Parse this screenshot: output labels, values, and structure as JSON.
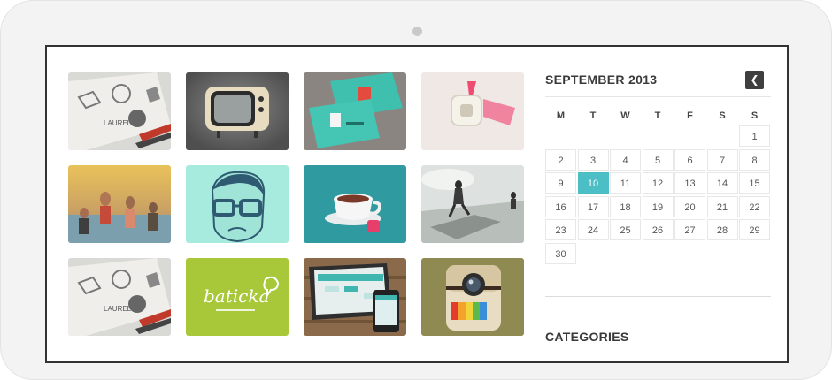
{
  "calendar": {
    "title": "SEPTEMBER 2013",
    "prev_icon": "chevron-left-icon",
    "weekdays": [
      "M",
      "T",
      "W",
      "T",
      "F",
      "S",
      "S"
    ],
    "today": "10",
    "days": [
      [
        "",
        "",
        "",
        "",
        "",
        "",
        "1"
      ],
      [
        "2",
        "3",
        "4",
        "5",
        "6",
        "7",
        "8"
      ],
      [
        "9",
        "10",
        "11",
        "12",
        "13",
        "14",
        "15"
      ],
      [
        "16",
        "17",
        "18",
        "19",
        "20",
        "21",
        "22"
      ],
      [
        "23",
        "24",
        "25",
        "26",
        "27",
        "28",
        "29"
      ],
      [
        "30",
        "",
        "",
        "",
        "",
        "",
        ""
      ]
    ]
  },
  "sidebar": {
    "categories_title": "CATEGORIES"
  },
  "gallery": {
    "thumbnails": [
      {
        "name": "logo-sketch-thumbnail",
        "label": "LAUREL"
      },
      {
        "name": "retro-tv-thumbnail"
      },
      {
        "name": "business-cards-thumbnail"
      },
      {
        "name": "pink-object-thumbnail"
      },
      {
        "name": "beach-people-thumbnail"
      },
      {
        "name": "man-glasses-illustration-thumbnail"
      },
      {
        "name": "coffee-cup-thumbnail"
      },
      {
        "name": "running-man-thumbnail"
      },
      {
        "name": "logo-sketch-thumbnail-2",
        "label": "LAUREL"
      },
      {
        "name": "baticka-logo-thumbnail",
        "label": "baticka"
      },
      {
        "name": "tablet-phone-thumbnail"
      },
      {
        "name": "instagram-camera-icon-thumbnail"
      }
    ]
  },
  "colors": {
    "accent": "#4bbec6",
    "dark": "#3f3f3f"
  }
}
